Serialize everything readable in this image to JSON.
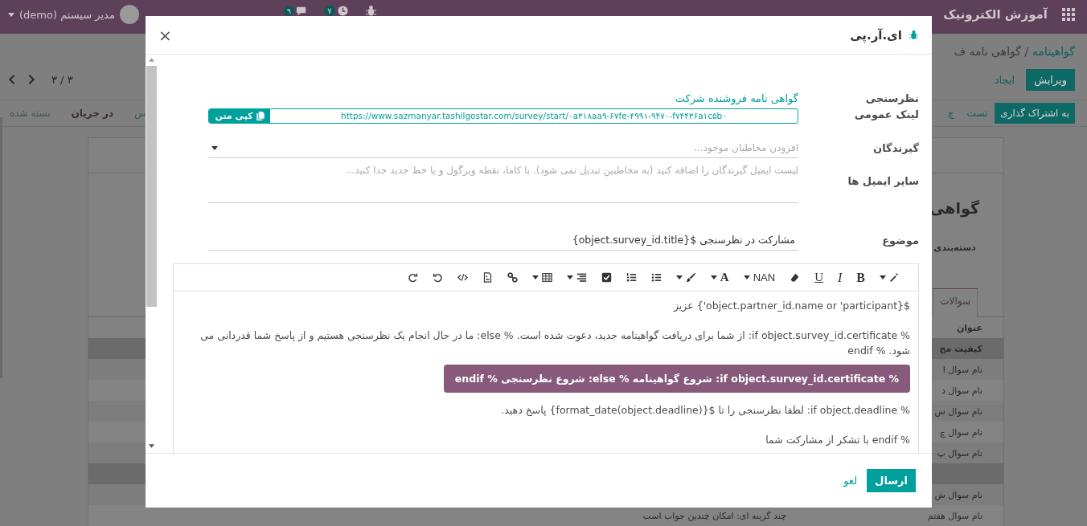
{
  "navbar": {
    "brand": "آموزش الکترونیک",
    "user": "مدیر سیستم (demo)",
    "chat_badge": "۹",
    "activity_badge": "۷"
  },
  "control_panel": {
    "breadcrumb_parent": "گواهینامه",
    "breadcrumb_current": "/ گواهی نامه ف",
    "edit_button": "ویرایش",
    "create_button": "ایجاد",
    "pager": "۳ / ۳"
  },
  "statusbar": {
    "actions": [
      "به اشتراک گذاری",
      "تست",
      "چ"
    ],
    "stages": [
      {
        "label": "س",
        "selected": false
      },
      {
        "label": "در جریان",
        "selected": true
      },
      {
        "label": "بسته شده",
        "selected": false
      }
    ]
  },
  "sheet": {
    "title": "گواهی",
    "field_label": "دسته‌بندی",
    "tabs": [
      {
        "label": "سوالات",
        "selected": true
      }
    ],
    "table": {
      "columns": [
        "عنوان"
      ],
      "rows": [
        {
          "kind": "section",
          "title": "کیفیت مح"
        },
        {
          "kind": "question",
          "title": "نام سوال ا"
        },
        {
          "kind": "question",
          "title": "نام سوال د"
        },
        {
          "kind": "question",
          "title": "نام سوال س"
        },
        {
          "kind": "question",
          "title": "نام سوال چ"
        },
        {
          "kind": "question",
          "title": "نام سوال پ"
        },
        {
          "kind": "section"
        },
        {
          "kind": "question",
          "title": "نام سوال ش"
        },
        {
          "kind": "question",
          "title": "نام سوال هفتم",
          "type": "چند گزینه ای: امکان چندین جواب است"
        }
      ]
    }
  },
  "dialog": {
    "title": "ای.آر.پی",
    "close": "×",
    "survey": {
      "label": "نظرسنجی",
      "value": "گواهی نامه فروشنده شرکت"
    },
    "public_link": {
      "label": "لینک عمومی",
      "url": "https://www.sazmanyar.tashilgostar.com/survey/start/۰a۳۱۸aa۹-۶۷fe-۴۹۹۱-۹۴۷۰-f۷۴۴۳۶a۱c۵b۰",
      "copy_button": "کپی متن"
    },
    "recipients": {
      "label": "گیرندگان",
      "placeholder": "افزودن مخاطبان موجود..."
    },
    "other_emails": {
      "label": "سایر ایمیل ها",
      "placeholder": "لیست ایمیل گیرندگان را اضافه کنید (به مخاطبین تبدیل نمی شود). با کاما، نقطه ویرگول و یا خط جدید جدا کنید..."
    },
    "subject": {
      "label": "موضوع",
      "value": "مشارکت در نظرسنجی ${object.survey_id.title}"
    },
    "editor": {
      "toolbar_labels": [
        "B",
        "I",
        "U",
        "NAN",
        "A"
      ],
      "paragraphs": [
        {
          "kind": "text",
          "text": "${object.partner_id.name or 'participant'} عزیز"
        },
        {
          "kind": "text",
          "text": "% if object.survey_id.certificate: از شما برای دریافت گواهینامه جدید، دعوت شده است. % else: ما در حال انجام یک نظرسنجی هستیم و از پاسخ شما قدردانی می شود. % endif"
        },
        {
          "kind": "button",
          "text": "% if object.survey_id.certificate: شروع گواهینامه % else: شروع نظرسنجی % endif"
        },
        {
          "kind": "text",
          "text": "% if object.deadline: لطفا نظرسنجی را تا ${format_date(object.deadline)} پاسخ دهید."
        },
        {
          "kind": "text",
          "text": "% endif با تشکر از مشارکت شما"
        }
      ]
    },
    "send_button": "ارسال",
    "cancel_button": "لغو"
  }
}
